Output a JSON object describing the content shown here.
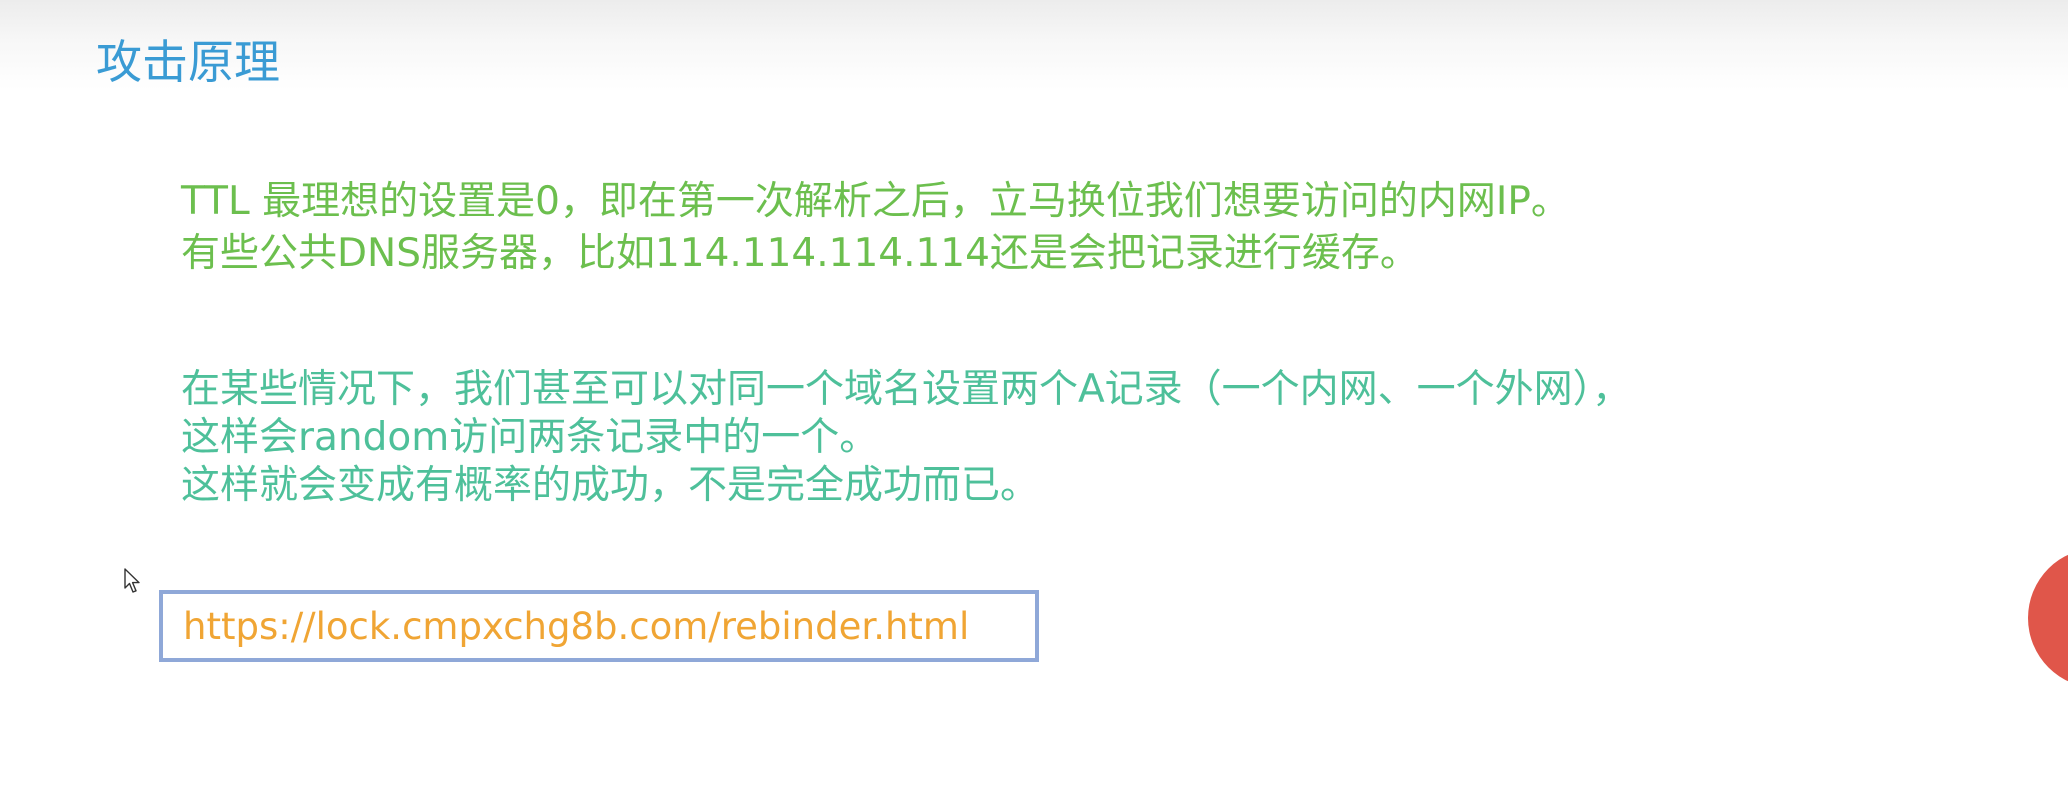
{
  "slide": {
    "title": "攻击原理",
    "paragraph1": [
      "TTL 最理想的设置是0，即在第一次解析之后，立马换位我们想要访问的内网IP。",
      "有些公共DNS服务器，比如114.114.114.114还是会把记录进行缓存。"
    ],
    "paragraph2": [
      "在某些情况下，我们甚至可以对同一个域名设置两个A记录（一个内网、一个外网），",
      "这样会random访问两条记录中的一个。",
      "这样就会变成有概率的成功，不是完全成功而已。"
    ],
    "link": "https://lock.cmpxchg8b.com/rebinder.html"
  },
  "colors": {
    "title": "#3a9bd4",
    "paragraph1": "#6cbf4e",
    "paragraph2": "#4ec09a",
    "link": "#f0a534",
    "link_border": "#8fa8d8",
    "corner_blob": "#e0564a"
  },
  "icons": {
    "cursor": "mouse-pointer-icon"
  }
}
